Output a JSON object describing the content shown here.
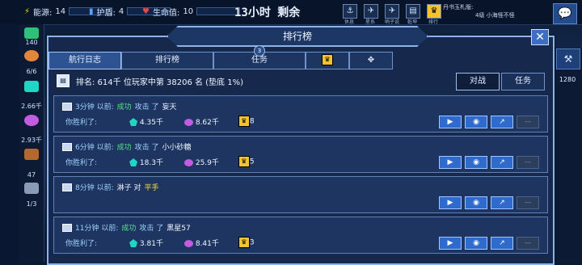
{
  "hud": {
    "energy_label": "能源:",
    "energy_value": "14",
    "shield_label": "护盾:",
    "shield_value": "4",
    "life_label": "生命值:",
    "life_value": "10",
    "timer": "13小时 剩余",
    "top_icons": [
      {
        "icon": "ship-icon",
        "label": "休息"
      },
      {
        "icon": "map-icon",
        "label": "星系"
      },
      {
        "icon": "fleet-icon",
        "label": "哨子说"
      },
      {
        "icon": "book-icon",
        "label": "乾坤"
      },
      {
        "icon": "crown-icon",
        "label": "排行"
      }
    ],
    "chat_lines": [
      "丹书玉札版:",
      "4级 小海怪不怪",
      "...."
    ]
  },
  "left_rail": [
    "140",
    "6/6",
    "2.66千",
    "2.93千",
    "47",
    "1/3"
  ],
  "right_rail": {
    "rank_value": "1280"
  },
  "panel": {
    "title": "排行榜",
    "tabs": [
      {
        "label": "航行日志",
        "active": true
      },
      {
        "label": "排行榜",
        "active": false
      },
      {
        "label": "任务",
        "active": false,
        "badge": "3"
      },
      {
        "label": "",
        "icon": "trophy-icon",
        "active": false
      },
      {
        "label": "",
        "icon": "move-icon",
        "active": false
      }
    ],
    "rank_text": "排名: 614千 位玩家中第 38206 名 (垫底 1%)",
    "segments": [
      {
        "label": "对战",
        "active": true
      },
      {
        "label": "任务",
        "active": false
      }
    ],
    "log": [
      {
        "time": "3分钟 以前:",
        "result": "成功",
        "verb": "攻击 了",
        "target": "妄天",
        "won_label": "你胜利了:",
        "crystal": "4.35千",
        "orb": "8.62千",
        "trophy": "8"
      },
      {
        "time": "6分钟 以前:",
        "result": "成功",
        "verb": "攻击 了",
        "target": "小小砂糖",
        "won_label": "你胜利了:",
        "crystal": "18.3千",
        "orb": "25.9千",
        "trophy": "5"
      },
      {
        "time": "8分钟 以前:",
        "result": "",
        "verb": "淋子 对",
        "target": "平手",
        "won_label": "",
        "crystal": "",
        "orb": "",
        "trophy": ""
      },
      {
        "time": "11分钟 以前:",
        "result": "成功",
        "verb": "攻击 了",
        "target": "黑星57",
        "won_label": "你胜利了:",
        "crystal": "3.81千",
        "orb": "8.41千",
        "trophy": "3"
      }
    ],
    "action_icons": [
      "video-icon",
      "eye-icon",
      "share-icon",
      "minus-icon"
    ]
  }
}
